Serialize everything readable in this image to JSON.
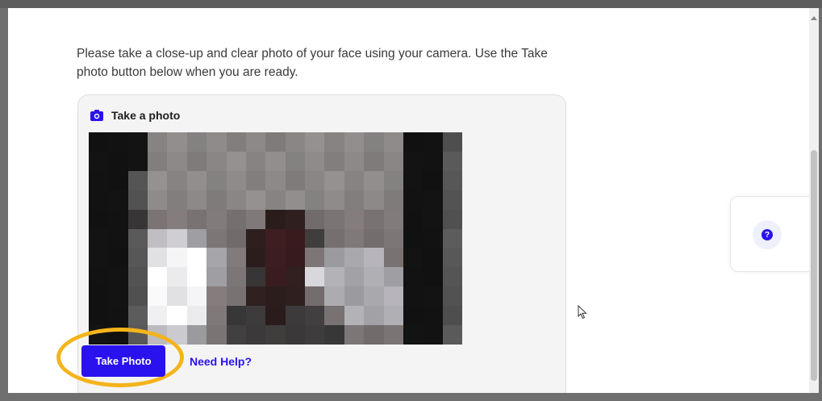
{
  "instructions": {
    "text": "Please take a close-up and clear photo of your face using your camera. Use the Take photo button below when you are ready."
  },
  "photo_card": {
    "title": "Take a photo",
    "camera_icon": "camera-icon"
  },
  "actions": {
    "take_photo_label": "Take Photo",
    "need_help_label": "Need Help?"
  },
  "help_widget": {
    "icon": "help-icon",
    "glyph": "?"
  },
  "colors": {
    "accent": "#2a12ee",
    "highlight": "#f4b41a",
    "card_background": "#f4f4f4"
  }
}
